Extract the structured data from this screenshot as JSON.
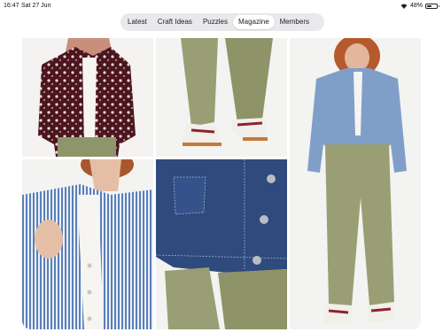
{
  "status": {
    "time": "16:47",
    "date": "Sat 27 Jun",
    "battery": "48%",
    "battery_level": 0.48
  },
  "tabs": [
    {
      "label": "Latest",
      "active": false
    },
    {
      "label": "Craft Ideas",
      "active": false
    },
    {
      "label": "Puzzles",
      "active": false
    },
    {
      "label": "Magazine",
      "active": true
    },
    {
      "label": "Members",
      "active": false
    }
  ],
  "photos": [
    {
      "subject": "floral-jacket-photo"
    },
    {
      "subject": "trousers-sneakers-photo"
    },
    {
      "subject": "denim-jacket-full-outfit-photo"
    },
    {
      "subject": "striped-jacket-photo"
    },
    {
      "subject": "denim-jacket-detail-photo"
    }
  ],
  "colors": {
    "tab_bar_bg": "#e9e9ec",
    "active_tab_bg": "#ffffff",
    "olive_trousers": "#9a9e74",
    "denim_light": "#7f9fc9",
    "denim_dark": "#2f4a7c",
    "floral_jacket": "#4a1622"
  }
}
